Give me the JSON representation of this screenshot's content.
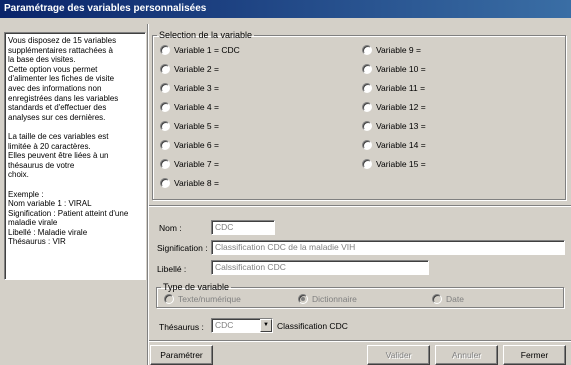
{
  "window": {
    "title": "Paramétrage des variables personnalisées"
  },
  "help_text": "Vous disposez de 15 variables\nsupplémentaires rattachées à\nla base des visites.\nCette option vous permet\nd'alimenter les fiches de visite\navec des informations non\nenregistrées dans les variables\nstandards et d'effectuer des\nanalyses sur ces dernières.\n\nLa taille de ces variables est\nlimitée à 20 caractères.\nElles peuvent être liées à un\nthésaurus de votre\nchoix.\n\nExemple :\nNom variable 1 : VIRAL\nSignification : Patient atteint d'une\nmaladie virale\nLibellé :  Maladie virale\nThésaurus : VIR",
  "selection": {
    "legend": "Selection de la variable",
    "variables": [
      {
        "label": "Variable 1 = CDC",
        "checked": false
      },
      {
        "label": "Variable 2 =",
        "checked": false
      },
      {
        "label": "Variable 3 =",
        "checked": false
      },
      {
        "label": "Variable 4 =",
        "checked": false
      },
      {
        "label": "Variable 5 =",
        "checked": false
      },
      {
        "label": "Variable 6 =",
        "checked": false
      },
      {
        "label": "Variable 7 =",
        "checked": false
      },
      {
        "label": "Variable 8 =",
        "checked": false
      },
      {
        "label": "Variable 9 =",
        "checked": false
      },
      {
        "label": "Variable 10 =",
        "checked": false
      },
      {
        "label": "Variable 11 =",
        "checked": false
      },
      {
        "label": "Variable 12 =",
        "checked": false
      },
      {
        "label": "Variable 13 =",
        "checked": false
      },
      {
        "label": "Variable 14 =",
        "checked": false
      },
      {
        "label": "Variable 15 =",
        "checked": false
      }
    ]
  },
  "form": {
    "nom_label": "Nom :",
    "nom_value": "CDC",
    "signification_label": "Signification :",
    "signification_value": "Classification CDC de la maladie VIH",
    "libelle_label": "Libellé :",
    "libelle_value": "Calssification CDC",
    "type_legend": "Type de variable",
    "type_options": [
      {
        "label": "Texte/numérique",
        "checked": false
      },
      {
        "label": "Dictionnaire",
        "checked": true
      },
      {
        "label": "Date",
        "checked": false
      }
    ],
    "thesaurus_label": "Thésaurus :",
    "thesaurus_value": "CDC",
    "thesaurus_desc": "Classification CDC"
  },
  "buttons": {
    "parametrer": "Paramétrer",
    "valider": "Valider",
    "annuler": "Annuler",
    "fermer": "Fermer"
  }
}
